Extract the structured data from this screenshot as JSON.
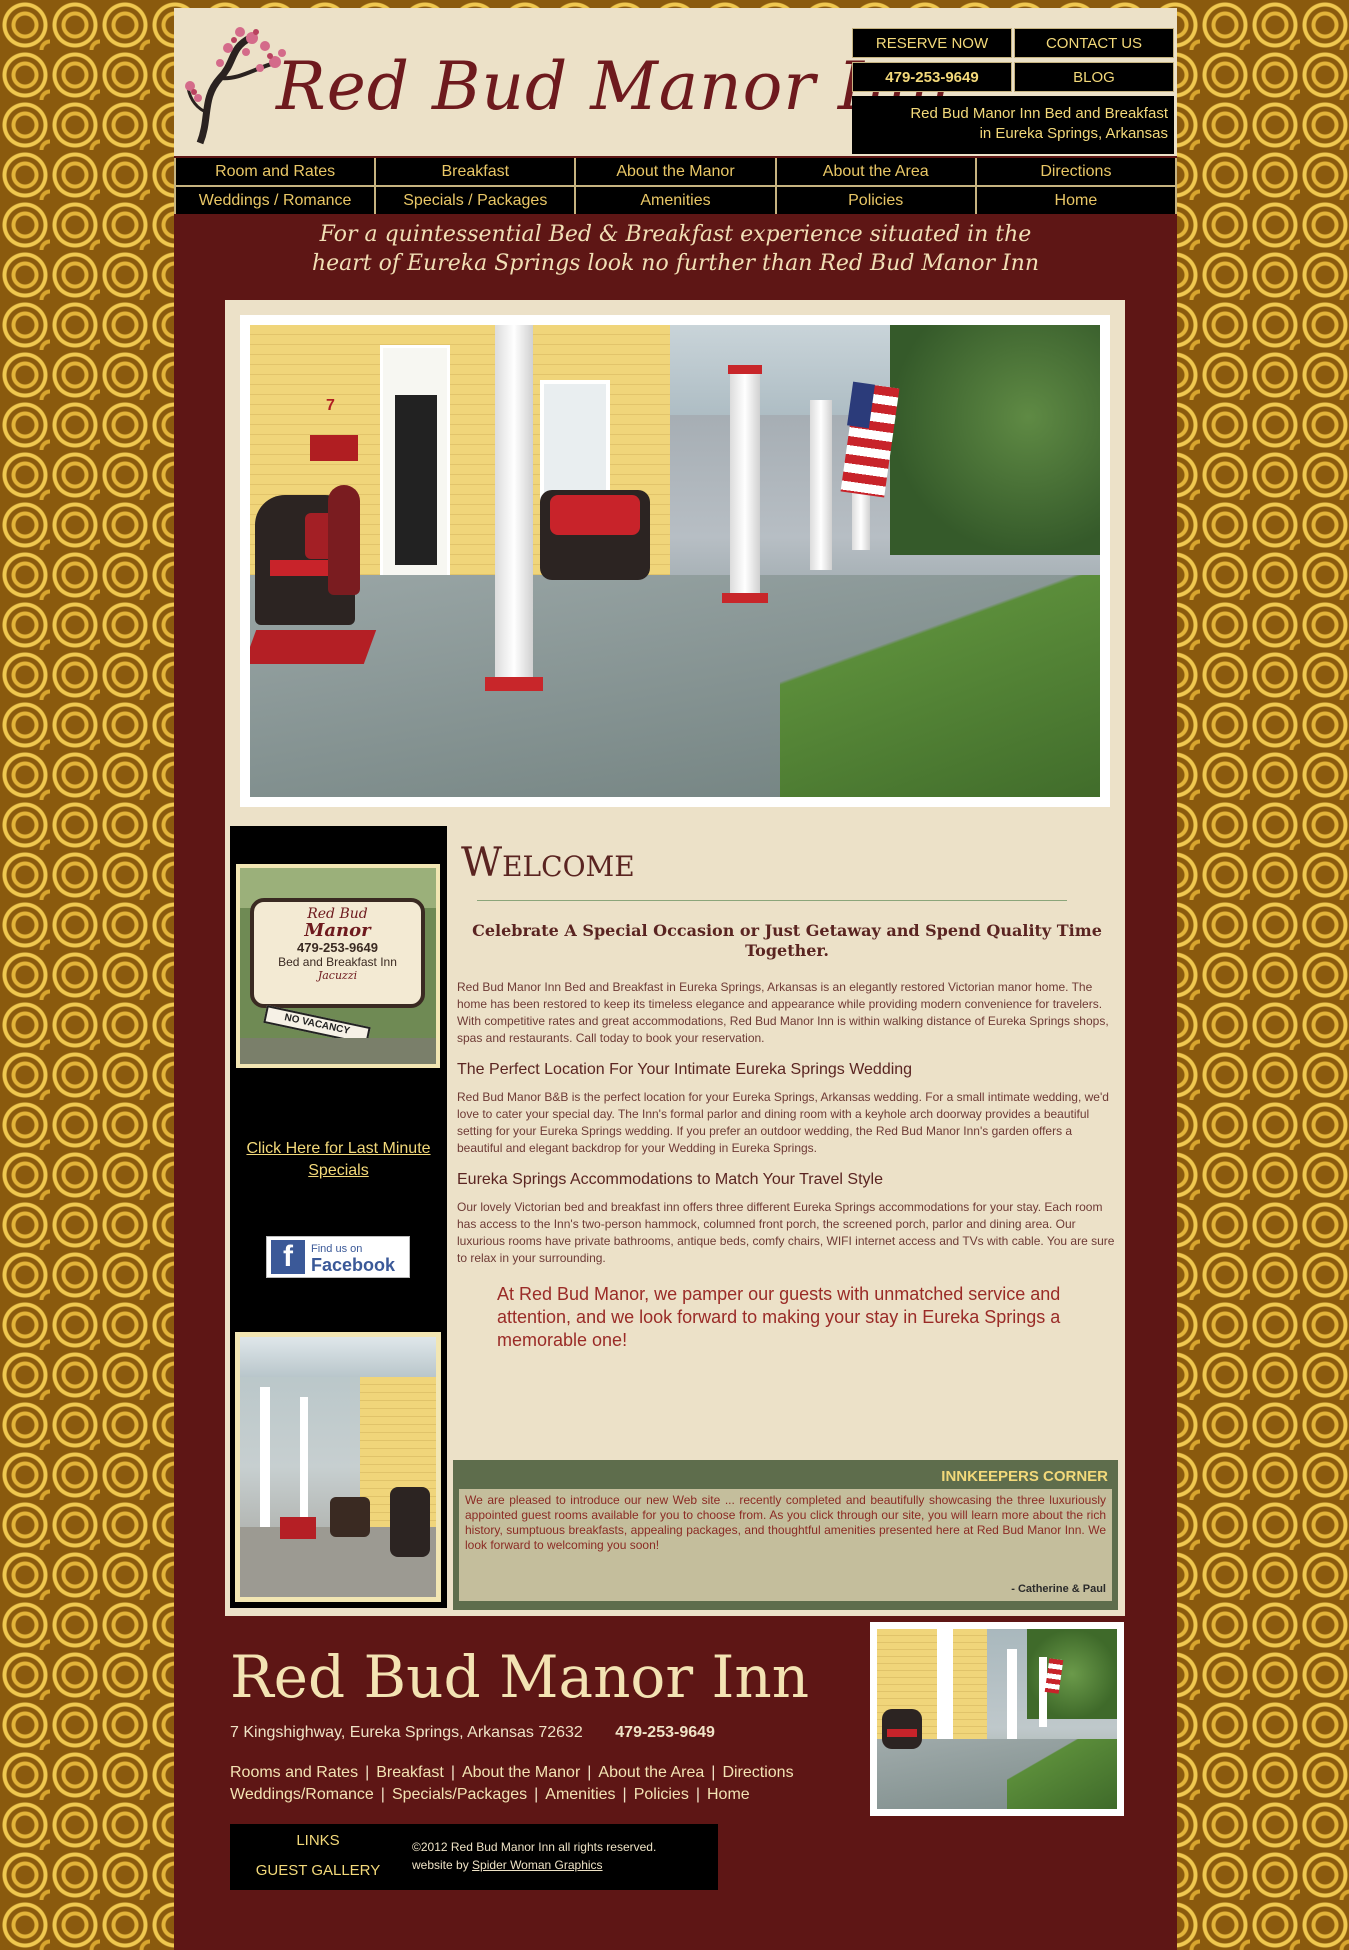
{
  "site": {
    "title": "Red Bud Manor Inn",
    "reserve": "RESERVE NOW",
    "contact": "CONTACT US",
    "phone": "479-253-9649",
    "blog": "BLOG",
    "descriptor_line1": "Red Bud Manor Inn Bed and Breakfast",
    "descriptor_line2": "in Eureka Springs, Arkansas"
  },
  "nav": {
    "items": [
      "Room and Rates",
      "Breakfast",
      "About the Manor",
      "About the Area",
      "Directions",
      "Weddings / Romance",
      "Specials / Packages",
      "Amenities",
      "Policies",
      "Home"
    ]
  },
  "tagline": {
    "line1": "For a quintessential Bed & Breakfast experience situated in the",
    "line2": "heart of Eureka Springs look no further than Red Bud Manor Inn"
  },
  "hero": {
    "house_number": "7"
  },
  "sidebar": {
    "sign_line1": "Red Bud",
    "sign_line2": "Manor",
    "sign_phone": "479-253-9649",
    "sign_line3": "Bed and Breakfast Inn",
    "sign_line4": "Jacuzzi",
    "sign_line5": "NO VACANCY",
    "specials_link": "Click Here for Last Minute Specials",
    "fb_line1": "Find us on",
    "fb_line2": "Facebook"
  },
  "content": {
    "welcome": "Welcome",
    "celebrate": "Celebrate A Special Occasion or Just Getaway and Spend Quality Time Together.",
    "para1": "Red Bud Manor Inn Bed and Breakfast in Eureka Springs, Arkansas is an elegantly restored Victorian manor home. The home has been restored to keep its timeless elegance and appearance while providing modern convenience for travelers. With competitive rates and great accommodations, Red Bud Manor Inn is within walking distance of Eureka Springs shops, spas and restaurants. Call today to book your reservation.",
    "sub1": "The Perfect Location For Your Intimate Eureka Springs Wedding",
    "para2": "Red Bud Manor B&B is the perfect location for your Eureka Springs, Arkansas wedding. For a small intimate wedding, we'd love to cater your special day. The Inn's formal parlor and dining room with a keyhole arch doorway provides a beautiful setting for your Eureka Springs wedding. If you prefer an outdoor wedding, the Red Bud Manor Inn's garden offers a beautiful and elegant backdrop for your Wedding in Eureka Springs.",
    "sub2": "Eureka Springs Accommodations to Match Your Travel Style",
    "para3": "Our lovely Victorian bed and breakfast inn offers three different Eureka Springs accommodations for your stay. Each room has access to the Inn's two-person hammock, columned front porch, the screened porch, parlor and dining area. Our luxurious rooms have private bathrooms, antique beds, comfy chairs, WIFI internet access and TVs with cable. You are sure to relax in your surrounding.",
    "pamper": "At Red Bud Manor, we pamper our guests with unmatched service and attention, and we look forward to making your stay in Eureka Springs a memorable one!"
  },
  "innkeepers": {
    "title": "INNKEEPERS CORNER",
    "body": "We are pleased to introduce our new Web site ... recently completed and beautifully showcasing the three luxuriously appointed guest rooms available for you to choose from.  As you click through our site, you will learn more about the rich history, sumptuous breakfasts, appealing packages, and thoughtful amenities presented here at Red Bud Manor Inn.  We look forward to welcoming you soon!",
    "signature": "- Catherine & Paul"
  },
  "footer": {
    "title": "Red Bud Manor Inn",
    "address": "7 Kingshighway, Eureka Springs, Arkansas 72632",
    "phone": "479-253-9649",
    "links_row1": [
      "Rooms and Rates",
      "Breakfast",
      "About the Manor",
      "About the Area",
      "Directions"
    ],
    "links_row2": [
      "Weddings/Romance",
      "Specials/Packages",
      "Amenities",
      "Policies",
      "Home"
    ],
    "box_link1": "LINKS",
    "box_link2": "GUEST GALLERY",
    "copyright": "©2012 Red Bud Manor Inn all rights reserved.",
    "website_by": "website by",
    "designer": "Spider Woman Graphics"
  },
  "colors": {
    "maroon": "#5e1615",
    "cream": "#ece1c8",
    "gold_text": "#f3d97a",
    "olive": "#5e6d4c"
  }
}
